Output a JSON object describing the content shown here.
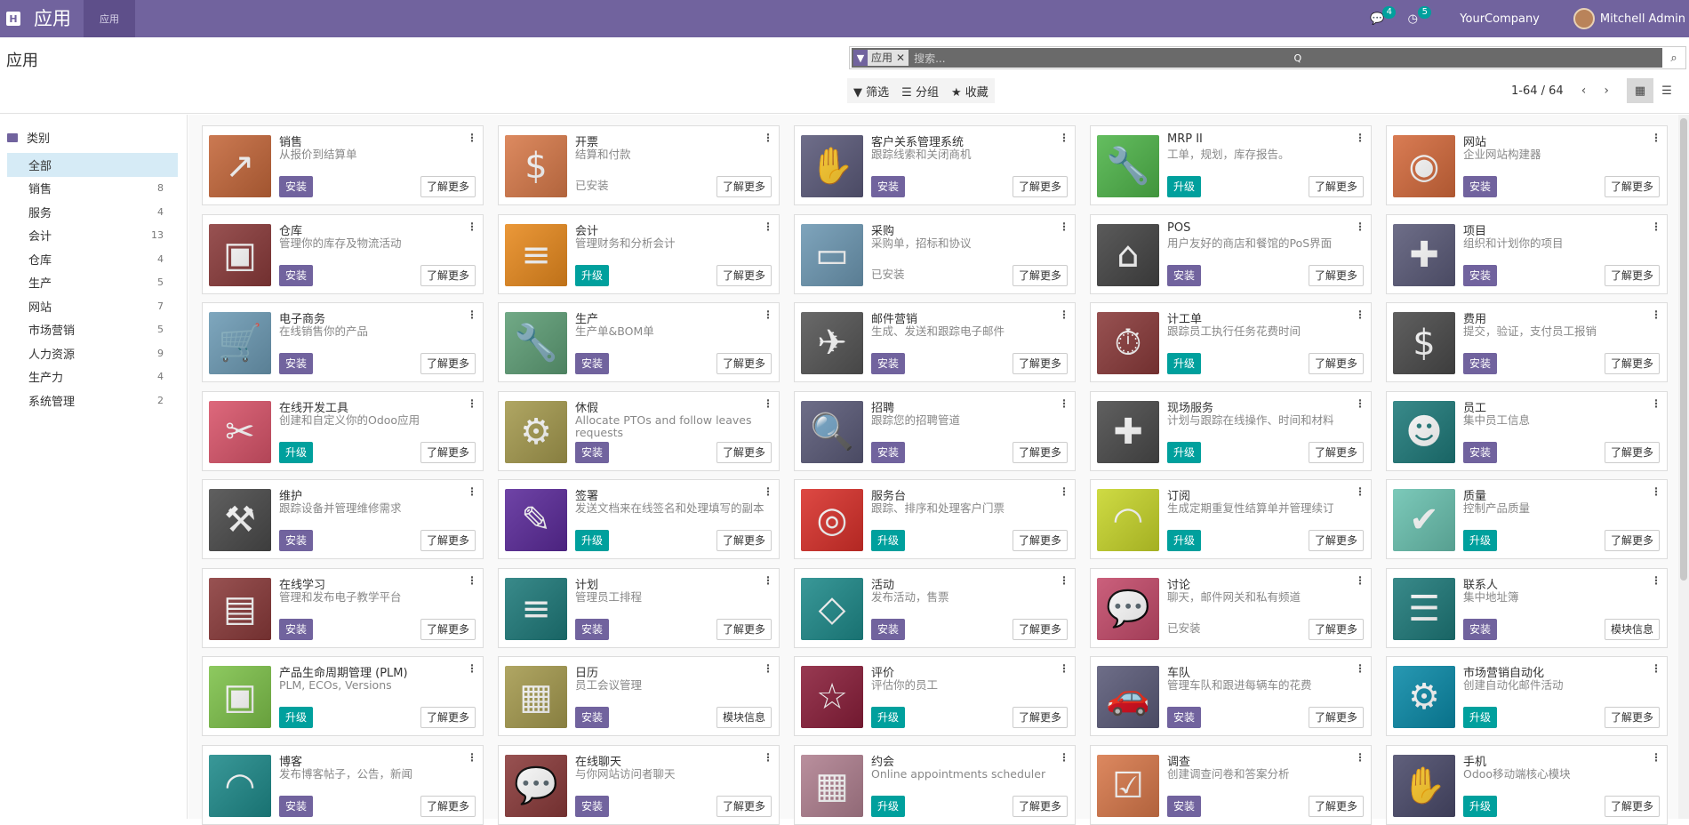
{
  "navbar": {
    "home_icon": "H",
    "app_title": "应用",
    "menu_label": "应用",
    "messages_badge": "4",
    "activities_badge": "5",
    "company": "YourCompany",
    "user": "Mitchell Admin"
  },
  "control_panel": {
    "page_title": "应用",
    "search": {
      "facet_label": "应用",
      "placeholder": "搜索...",
      "q_label": "Q"
    },
    "filters": [
      "筛选",
      "分组",
      "收藏"
    ],
    "pager": "1-64 / 64"
  },
  "sidebar": {
    "heading": "类别",
    "items": [
      {
        "label": "全部",
        "count": ""
      },
      {
        "label": "销售",
        "count": "8"
      },
      {
        "label": "服务",
        "count": "4"
      },
      {
        "label": "会计",
        "count": "13"
      },
      {
        "label": "仓库",
        "count": "4"
      },
      {
        "label": "生产",
        "count": "5"
      },
      {
        "label": "网站",
        "count": "7"
      },
      {
        "label": "市场营销",
        "count": "5"
      },
      {
        "label": "人力资源",
        "count": "9"
      },
      {
        "label": "生产力",
        "count": "4"
      },
      {
        "label": "系统管理",
        "count": "2"
      }
    ]
  },
  "apps": [
    {
      "name": "销售",
      "desc": "从报价到结算单",
      "action": "安装",
      "more": "了解更多",
      "color": "#c4673a",
      "glyph": "↗"
    },
    {
      "name": "开票",
      "desc": "结算和付款",
      "action": "已安装",
      "more": "了解更多",
      "color": "#d87a4a",
      "glyph": "$"
    },
    {
      "name": "客户关系管理系统",
      "desc": "跟踪线索和关闭商机",
      "action": "安装",
      "more": "了解更多",
      "color": "#5b5a7a",
      "glyph": "✋"
    },
    {
      "name": "MRP II",
      "desc": "工单，规划，库存报告。",
      "action": "升级",
      "more": "了解更多",
      "color": "#4fb54a",
      "glyph": "🔧"
    },
    {
      "name": "网站",
      "desc": "企业网站构建器",
      "action": "安装",
      "more": "了解更多",
      "color": "#d46a3c",
      "glyph": "◉"
    },
    {
      "name": "仓库",
      "desc": "管理你的库存及物流活动",
      "action": "安装",
      "more": "了解更多",
      "color": "#8a3a3a",
      "glyph": "▣"
    },
    {
      "name": "会计",
      "desc": "管理财务和分析会计",
      "action": "升级",
      "more": "了解更多",
      "color": "#e88a1e",
      "glyph": "≡"
    },
    {
      "name": "采购",
      "desc": "采购单，招标和协议",
      "action": "已安装",
      "more": "了解更多",
      "color": "#6d98b3",
      "glyph": "▭"
    },
    {
      "name": "POS",
      "desc": "用户友好的商店和餐馆的PoS界面",
      "action": "安装",
      "more": "了解更多",
      "color": "#444444",
      "glyph": "⌂"
    },
    {
      "name": "项目",
      "desc": "组织和计划你的项目",
      "action": "安装",
      "more": "了解更多",
      "color": "#5a5a78",
      "glyph": "✚"
    },
    {
      "name": "电子商务",
      "desc": "在线销售你的产品",
      "action": "安装",
      "more": "了解更多",
      "color": "#6d9bb5",
      "glyph": "🛒"
    },
    {
      "name": "生产",
      "desc": "生产单&BOM单",
      "action": "安装",
      "more": "了解更多",
      "color": "#5e9e76",
      "glyph": "🔧"
    },
    {
      "name": "邮件营销",
      "desc": "生成、发送和跟踪电子邮件",
      "action": "安装",
      "more": "了解更多",
      "color": "#555555",
      "glyph": "✈"
    },
    {
      "name": "计工单",
      "desc": "跟踪员工执行任务花费时间",
      "action": "升级",
      "more": "了解更多",
      "color": "#8a3a3a",
      "glyph": "⏱"
    },
    {
      "name": "费用",
      "desc": "提交，验证，支付员工报销",
      "action": "安装",
      "more": "了解更多",
      "color": "#4a4a4a",
      "glyph": "$"
    },
    {
      "name": "在线开发工具",
      "desc": "创建和自定义你的Odoo应用",
      "action": "升级",
      "more": "了解更多",
      "color": "#d9546a",
      "glyph": "✂"
    },
    {
      "name": "休假",
      "desc": "Allocate PTOs and follow leaves requests",
      "action": "安装",
      "more": "了解更多",
      "color": "#a59a4e",
      "glyph": "⚙"
    },
    {
      "name": "招聘",
      "desc": "跟踪您的招聘管道",
      "action": "安装",
      "more": "了解更多",
      "color": "#5a5a78",
      "glyph": "🔍"
    },
    {
      "name": "现场服务",
      "desc": "计划与跟踪在线操作、时间和材料",
      "action": "升级",
      "more": "了解更多",
      "color": "#4a4a4a",
      "glyph": "✚"
    },
    {
      "name": "员工",
      "desc": "集中员工信息",
      "action": "安装",
      "more": "了解更多",
      "color": "#1e7a7a",
      "glyph": "☻"
    },
    {
      "name": "维护",
      "desc": "跟踪设备并管理维修需求",
      "action": "安装",
      "more": "了解更多",
      "color": "#4a4a4a",
      "glyph": "⚒"
    },
    {
      "name": "签署",
      "desc": "发送文档来在线签名和处理填写的副本",
      "action": "升级",
      "more": "了解更多",
      "color": "#5b2a9a",
      "glyph": "✎"
    },
    {
      "name": "服务台",
      "desc": "跟踪、排序和处理客户门票",
      "action": "升级",
      "more": "了解更多",
      "color": "#d9302a",
      "glyph": "◎"
    },
    {
      "name": "订阅",
      "desc": "生成定期重复性结算单并管理续订",
      "action": "升级",
      "more": "了解更多",
      "color": "#c8d62a",
      "glyph": "◠"
    },
    {
      "name": "质量",
      "desc": "控制产品质量",
      "action": "升级",
      "more": "了解更多",
      "color": "#6ac2b0",
      "glyph": "✔"
    },
    {
      "name": "在线学习",
      "desc": "管理和发布电子教学平台",
      "action": "安装",
      "more": "了解更多",
      "color": "#8a3a3a",
      "glyph": "▤"
    },
    {
      "name": "计划",
      "desc": "管理员工排程",
      "action": "安装",
      "more": "了解更多",
      "color": "#1e7a7a",
      "glyph": "≡"
    },
    {
      "name": "活动",
      "desc": "发布活动，售票",
      "action": "安装",
      "more": "了解更多",
      "color": "#1e8a8a",
      "glyph": "◇"
    },
    {
      "name": "讨论",
      "desc": "聊天，邮件网关和私有频道",
      "action": "已安装",
      "more": "了解更多",
      "color": "#c44a6a",
      "glyph": "💬"
    },
    {
      "name": "联系人",
      "desc": "集中地址簿",
      "action": "安装",
      "more": "模块信息",
      "color": "#1e7a7a",
      "glyph": "☰"
    },
    {
      "name": "产品生命周期管理 (PLM)",
      "desc": "PLM, ECOs, Versions",
      "action": "升级",
      "more": "了解更多",
      "color": "#7ec24a",
      "glyph": "▣"
    },
    {
      "name": "日历",
      "desc": "员工会议管理",
      "action": "安装",
      "more": "模块信息",
      "color": "#a59a4e",
      "glyph": "▦"
    },
    {
      "name": "评价",
      "desc": "评估你的员工",
      "action": "升级",
      "more": "了解更多",
      "color": "#8a1e3a",
      "glyph": "☆"
    },
    {
      "name": "车队",
      "desc": "管理车队和跟进每辆车的花费",
      "action": "安装",
      "more": "了解更多",
      "color": "#5a5a78",
      "glyph": "🚗"
    },
    {
      "name": "市场营销自动化",
      "desc": "创建自动化邮件活动",
      "action": "升级",
      "more": "了解更多",
      "color": "#0a8aa8",
      "glyph": "⚙"
    },
    {
      "name": "博客",
      "desc": "发布博客帖子，公告，新闻",
      "action": "安装",
      "more": "了解更多",
      "color": "#1e8a8a",
      "glyph": "◠"
    },
    {
      "name": "在线聊天",
      "desc": "与你网站访问者聊天",
      "action": "安装",
      "more": "了解更多",
      "color": "#8a3a3a",
      "glyph": "💬"
    },
    {
      "name": "约会",
      "desc": "Online appointments scheduler",
      "action": "升级",
      "more": "了解更多",
      "color": "#b08090",
      "glyph": "▦"
    },
    {
      "name": "调查",
      "desc": "创建调查问卷和答案分析",
      "action": "安装",
      "more": "了解更多",
      "color": "#d8784a",
      "glyph": "☑"
    },
    {
      "name": "手机",
      "desc": "Odoo移动端核心模块",
      "action": "升级",
      "more": "了解更多",
      "color": "#4a4a6a",
      "glyph": "✋"
    }
  ]
}
